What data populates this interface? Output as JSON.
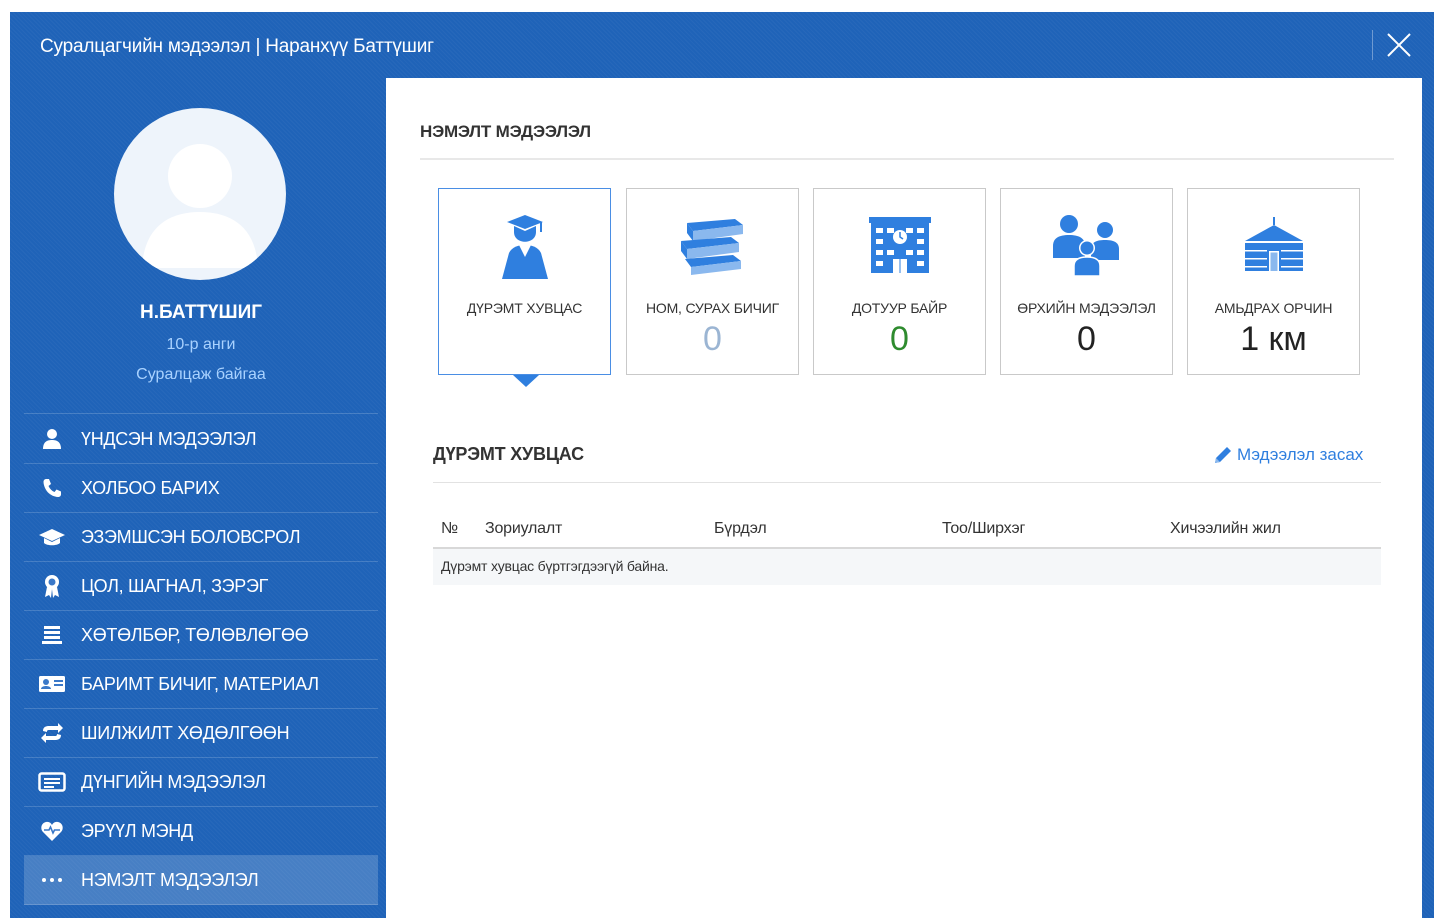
{
  "window": {
    "title": "Суралцагчийн мэдээлэл | Наранхүү Баттүшиг"
  },
  "profile": {
    "name": "Н.БАТТҮШИГ",
    "grade": "10-р анги",
    "status": "Суралцаж байгаа"
  },
  "sidebar": {
    "items": [
      {
        "label": "ҮНДСЭН МЭДЭЭЛЭЛ",
        "icon": "user-icon"
      },
      {
        "label": "ХОЛБОО БАРИХ",
        "icon": "phone-icon"
      },
      {
        "label": "ЭЗЭМШСЭН БОЛОВСРОЛ",
        "icon": "graduation-cap-icon"
      },
      {
        "label": "ЦОЛ, ШАГНАЛ, ЗЭРЭГ",
        "icon": "award-icon"
      },
      {
        "label": "ХӨТӨЛБӨР, ТӨЛӨВЛӨГӨӨ",
        "icon": "list-icon"
      },
      {
        "label": "БАРИМТ БИЧИГ, МАТЕРИАЛ",
        "icon": "id-card-icon"
      },
      {
        "label": "ШИЛЖИЛТ ХӨДӨЛГӨӨН",
        "icon": "exchange-icon"
      },
      {
        "label": "ДҮНГИЙН МЭДЭЭЛЭЛ",
        "icon": "grades-icon"
      },
      {
        "label": "ЭРҮҮЛ МЭНД",
        "icon": "heart-icon"
      },
      {
        "label": "НЭМЭЛТ МЭДЭЭЛЭЛ",
        "icon": "ellipsis-icon",
        "active": true
      }
    ]
  },
  "main": {
    "section_title": "НЭМЭЛТ МЭДЭЭЛЭЛ",
    "cards": [
      {
        "label": "ДҮРЭМТ ХУВЦАС",
        "value": "",
        "icon": "graduate-icon",
        "active": true
      },
      {
        "label": "НОМ, СУРАХ БИЧИГ",
        "value": "0",
        "icon": "books-icon",
        "value_color": "#9bb5d3"
      },
      {
        "label": "ДОТУУР БАЙР",
        "value": "0",
        "icon": "dormitory-icon",
        "value_color": "#2e8b2e"
      },
      {
        "label": "ӨРХИЙН МЭДЭЭЛЭЛ",
        "value": "0",
        "icon": "family-icon",
        "value_color": "#222222"
      },
      {
        "label": "АМЬДРАХ ОРЧИН",
        "value": "1 км",
        "icon": "ger-icon",
        "value_color": "#222222"
      }
    ],
    "subsection_title": "ДҮРЭМТ ХУВЦАС",
    "edit_label": "Мэдээлэл засах",
    "table": {
      "columns": [
        "№",
        "Зориулалт",
        "Бүрдэл",
        "Тоо/Ширхэг",
        "Хичээлийн жил"
      ],
      "empty_message": "Дүрэмт хувцас бүртгэгдээгүй байна."
    }
  },
  "colors": {
    "accent": "#1f63b8",
    "icon_blue": "#2f7fdf",
    "link": "#2f7fdf"
  }
}
